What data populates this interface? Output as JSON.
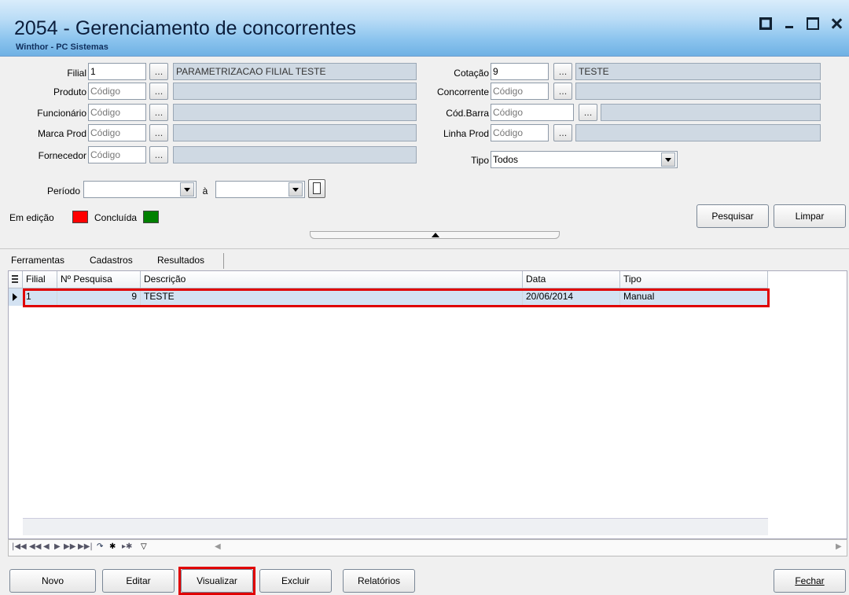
{
  "window": {
    "title": "2054 - Gerenciamento de concorrentes",
    "subtitle": "Winthor - PC Sistemas"
  },
  "filters": {
    "filial": {
      "label": "Filial",
      "value": "1",
      "description": "PARAMETRIZACAO FILIAL TESTE"
    },
    "produto": {
      "label": "Produto",
      "placeholder": "Código"
    },
    "funcionario": {
      "label": "Funcionário",
      "placeholder": "Código"
    },
    "marca_prod": {
      "label": "Marca Prod",
      "placeholder": "Código"
    },
    "fornecedor": {
      "label": "Fornecedor",
      "placeholder": "Código"
    },
    "cotacao": {
      "label": "Cotação",
      "value": "9",
      "description": "TESTE"
    },
    "concorrente": {
      "label": "Concorrente",
      "placeholder": "Código"
    },
    "cod_barra": {
      "label": "Cód.Barra",
      "placeholder": "Código"
    },
    "linha_prod": {
      "label": "Linha Prod",
      "placeholder": "Código"
    },
    "tipo": {
      "label": "Tipo",
      "value": "Todos"
    },
    "periodo": {
      "label": "Período",
      "separator": "à"
    },
    "ellipsis": "..."
  },
  "legend": {
    "em_edicao": {
      "label": "Em edição",
      "color": "#ff0000"
    },
    "concluida": {
      "label": "Concluída",
      "color": "#008000"
    }
  },
  "actions": {
    "pesquisar": "Pesquisar",
    "limpar": "Limpar"
  },
  "menu": {
    "ferramentas": "Ferramentas",
    "cadastros": "Cadastros",
    "resultados": "Resultados"
  },
  "table": {
    "columns": [
      "Filial",
      "Nº Pesquisa",
      "Descrição",
      "Data",
      "Tipo"
    ],
    "rows": [
      {
        "filial": "1",
        "n_pesquisa": "9",
        "descricao": "TESTE",
        "data": "20/06/2014",
        "tipo": "Manual"
      }
    ]
  },
  "footer": {
    "novo": "Novo",
    "editar": "Editar",
    "visualizar": "Visualizar",
    "excluir": "Excluir",
    "relatorios": "Relatórios",
    "fechar": "Fechar"
  },
  "colors": {
    "highlight": "#e00000",
    "row_selected": "#d3e2f2"
  }
}
